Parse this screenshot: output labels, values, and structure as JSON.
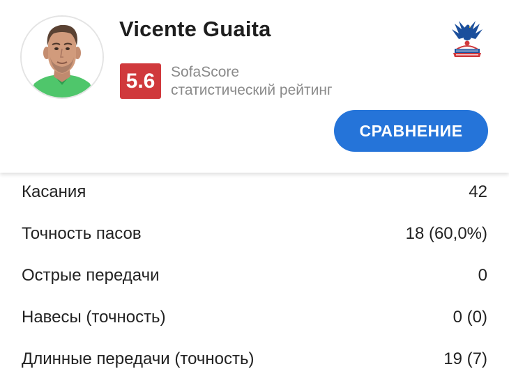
{
  "player": {
    "name": "Vicente Guaita",
    "avatar_icon": "player-photo",
    "club_logo_icon": "eagle-crest-icon"
  },
  "rating": {
    "value": "5.6",
    "source": "SofaScore",
    "description": "статистический рейтинг",
    "badge_color": "#d0393c"
  },
  "actions": {
    "compare_label": "СРАВНЕНИЕ",
    "compare_color": "#2574d9"
  },
  "stats": [
    {
      "label": "Касания",
      "value": "42"
    },
    {
      "label": "Точность пасов",
      "value": "18 (60,0%)"
    },
    {
      "label": "Острые передачи",
      "value": "0"
    },
    {
      "label": "Навесы (точность)",
      "value": "0 (0)"
    },
    {
      "label": "Длинные передачи (точность)",
      "value": "19 (7)"
    }
  ]
}
